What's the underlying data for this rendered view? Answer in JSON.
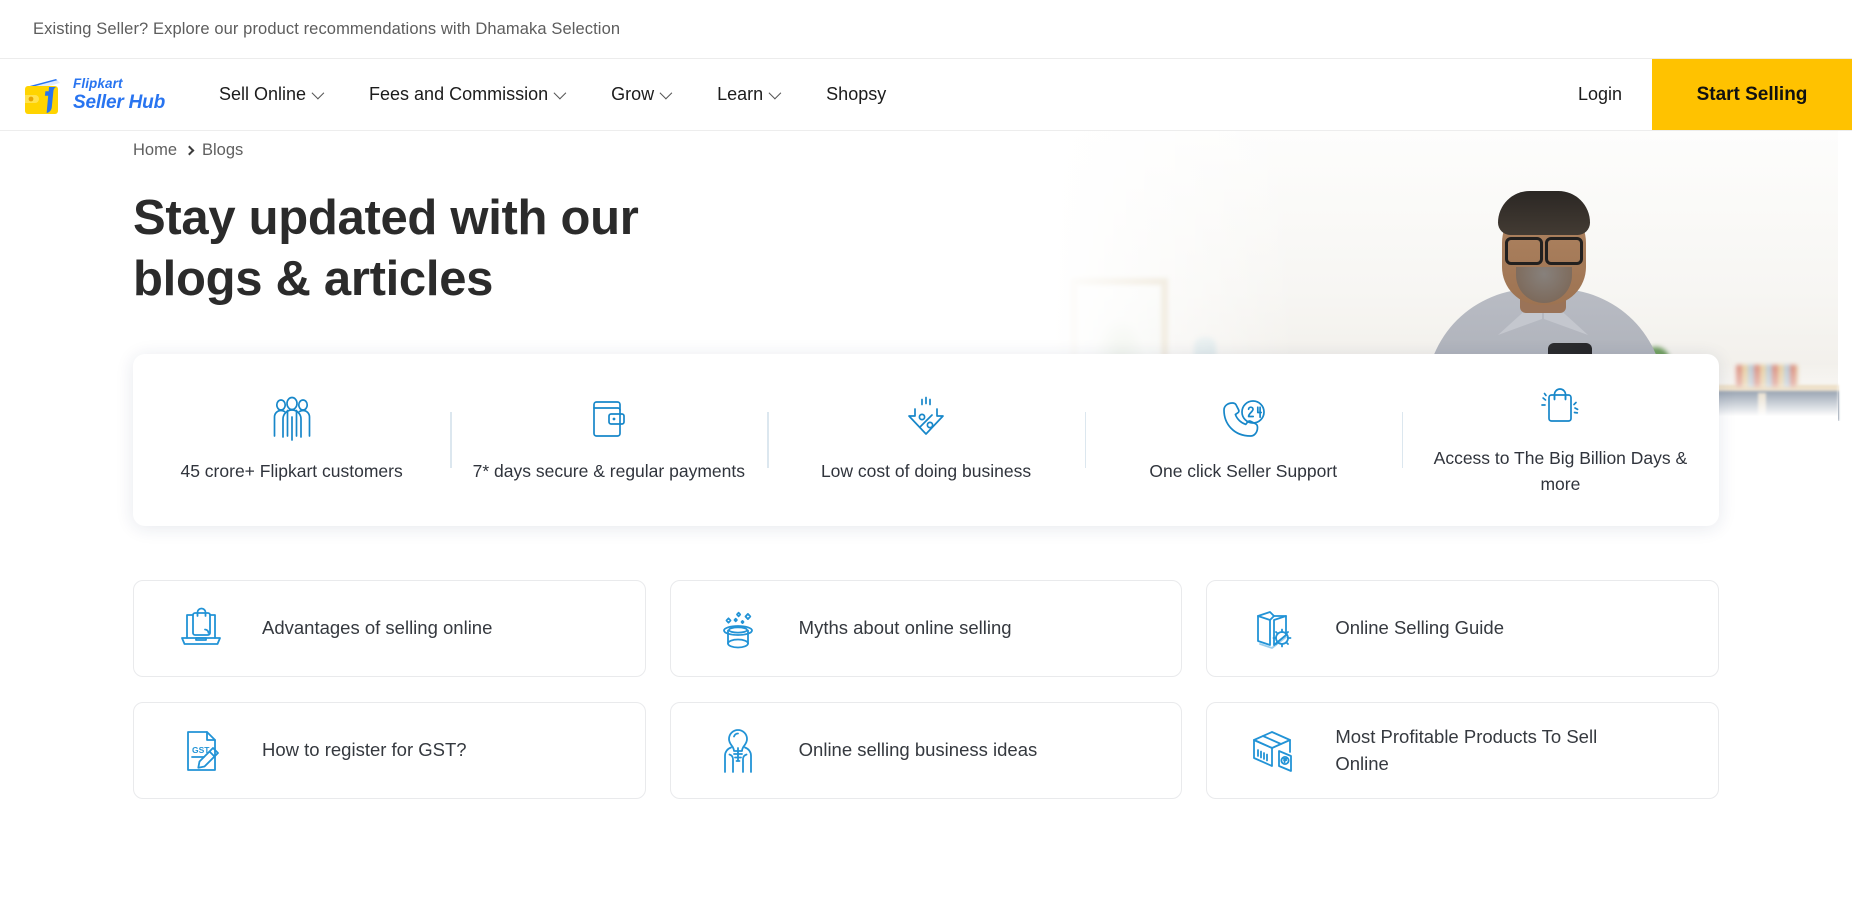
{
  "announcement": {
    "text": "Existing Seller? Explore our product recommendations with Dhamaka Selection"
  },
  "brand": {
    "name_top": "Flipkart",
    "name_bottom": "Seller Hub",
    "logo_yellow": "#FFD400",
    "logo_blue": "#2874F0"
  },
  "nav": {
    "items": [
      {
        "label": "Sell Online",
        "has_caret": true
      },
      {
        "label": "Fees and Commission",
        "has_caret": true
      },
      {
        "label": "Grow",
        "has_caret": true
      },
      {
        "label": "Learn",
        "has_caret": true
      },
      {
        "label": "Shopsy",
        "has_caret": false
      }
    ],
    "login_label": "Login",
    "cta_label": "Start Selling",
    "cta_color": "#FFC200"
  },
  "hero": {
    "breadcrumb": [
      "Home",
      "Blogs"
    ],
    "title": "Stay updated with our blogs & articles"
  },
  "benefits": {
    "accent_color": "#1787C9",
    "items": [
      {
        "icon": "people-group-icon",
        "label": "45 crore+ Flipkart customers"
      },
      {
        "icon": "wallet-icon",
        "label": "7* days secure & regular payments"
      },
      {
        "icon": "percent-down-arrow-icon",
        "label": "Low cost of doing business"
      },
      {
        "icon": "support-24-phone-icon",
        "label": "One click Seller Support"
      },
      {
        "icon": "shopping-bag-sparkle-icon",
        "label": "Access to The Big Billion Days & more"
      }
    ]
  },
  "topics": {
    "items": [
      {
        "icon": "laptop-bag-icon",
        "label": "Advantages of selling online"
      },
      {
        "icon": "magic-hat-icon",
        "label": "Myths about online selling"
      },
      {
        "icon": "book-gear-icon",
        "label": "Online Selling Guide"
      },
      {
        "icon": "gst-document-pencil-icon",
        "label": "How to register for GST?"
      },
      {
        "icon": "lightbulb-hands-icon",
        "label": "Online selling business ideas"
      },
      {
        "icon": "package-price-tag-icon",
        "label": "Most Profitable Products To Sell Online"
      }
    ]
  }
}
